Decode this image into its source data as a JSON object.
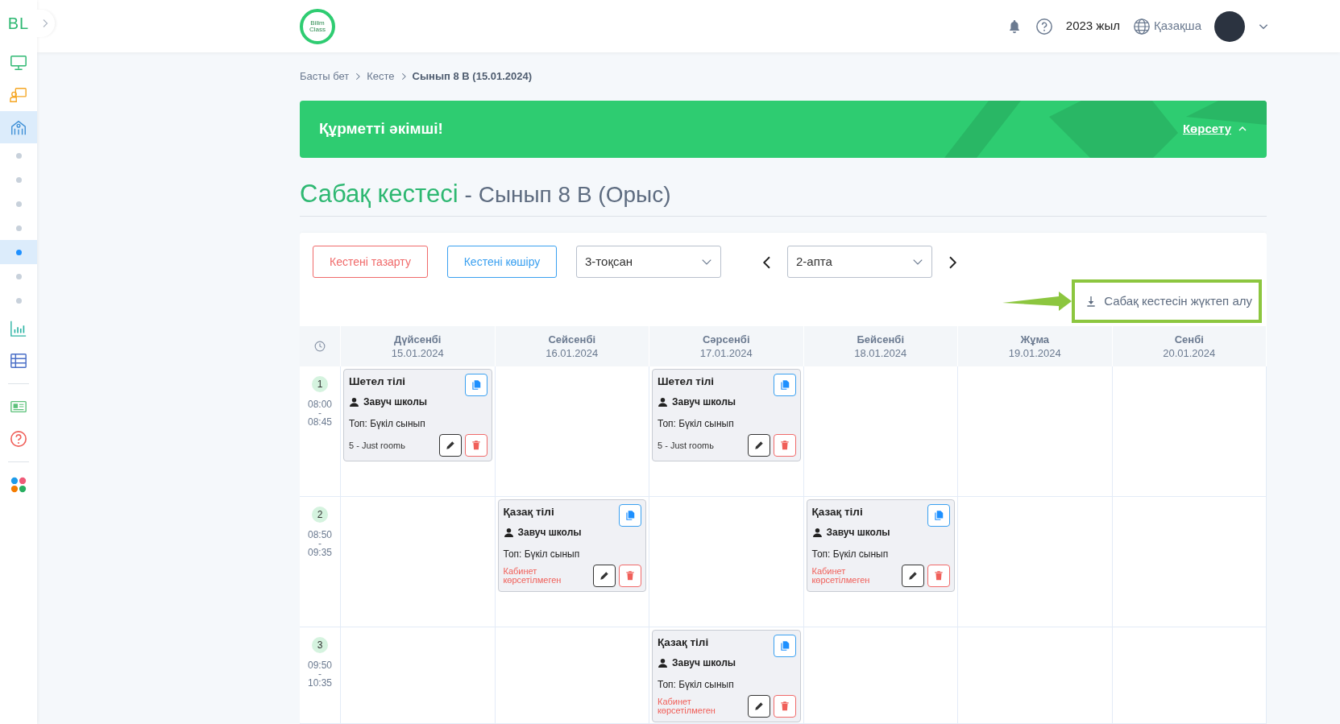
{
  "sidebar": {
    "logo": "BL",
    "items": [
      {
        "kind": "monitor",
        "selected": false
      },
      {
        "kind": "classroom",
        "selected": false
      },
      {
        "kind": "school",
        "selected": true
      },
      {
        "kind": "dot",
        "selected": false
      },
      {
        "kind": "dot",
        "selected": false
      },
      {
        "kind": "dot",
        "selected": false
      },
      {
        "kind": "dot",
        "selected": false
      },
      {
        "kind": "dot",
        "selected": true
      },
      {
        "kind": "dot",
        "selected": false
      },
      {
        "kind": "dot",
        "selected": false
      },
      {
        "kind": "chart",
        "selected": false
      },
      {
        "kind": "table",
        "selected": false
      },
      {
        "kind": "divider"
      },
      {
        "kind": "news",
        "selected": false
      },
      {
        "kind": "help",
        "selected": false
      },
      {
        "kind": "divider"
      },
      {
        "kind": "apps",
        "selected": false
      }
    ]
  },
  "header": {
    "logo_text": "Bilim Class",
    "year": "2023 жыл",
    "language": "Қазақша"
  },
  "breadcrumb": [
    {
      "label": "Басты бет",
      "current": false
    },
    {
      "label": "Кесте",
      "current": false
    },
    {
      "label": "Сынып 8 В (15.01.2024)",
      "current": true
    }
  ],
  "banner": {
    "title": "Құрметті әкімші!",
    "toggle": "Көрсету",
    "expanded": true
  },
  "page_title": {
    "main": "Сабақ кестесі",
    "sub": "- Сынып 8 В (Орыс)"
  },
  "toolbar": {
    "clear_button": "Кестені тазарту",
    "copy_button": "Кестені көшіру",
    "quarter": "3-тоқсан",
    "week": "2-апта",
    "download": "Сабақ кестесін жүктеп алу",
    "download_highlighted": true
  },
  "schedule": {
    "days": [
      {
        "name": "Дүйсенбі",
        "date": "15.01.2024"
      },
      {
        "name": "Сейсенбі",
        "date": "16.01.2024"
      },
      {
        "name": "Сәрсенбі",
        "date": "17.01.2024"
      },
      {
        "name": "Бейсенбі",
        "date": "18.01.2024"
      },
      {
        "name": "Жұма",
        "date": "19.01.2024"
      },
      {
        "name": "Сенбі",
        "date": "20.01.2024"
      }
    ],
    "rows": [
      {
        "number": "1",
        "time": "08:00\n-\n08:45",
        "cells": [
          {
            "subject": "Шетел тілі",
            "teacher": "Завуч школы",
            "group": "Топ: Бүкіл сынып",
            "room": "5 - Just roomь",
            "room_assigned": true
          },
          null,
          {
            "subject": "Шетел тілі",
            "teacher": "Завуч школы",
            "group": "Топ: Бүкіл сынып",
            "room": "5 - Just roomь",
            "room_assigned": true
          },
          null,
          null,
          null
        ]
      },
      {
        "number": "2",
        "time": "08:50\n-\n09:35",
        "cells": [
          null,
          {
            "subject": "Қазақ тілі",
            "teacher": "Завуч школы",
            "group": "Топ: Бүкіл сынып",
            "room": "Кабинет көрсетілмеген",
            "room_assigned": false
          },
          null,
          {
            "subject": "Қазақ тілі",
            "teacher": "Завуч школы",
            "group": "Топ: Бүкіл сынып",
            "room": "Кабинет көрсетілмеген",
            "room_assigned": false
          },
          null,
          null
        ]
      },
      {
        "number": "3",
        "time": "09:50\n-\n10:35",
        "cells": [
          null,
          null,
          {
            "subject": "Қазақ тілі",
            "teacher": "Завуч школы",
            "group": "Топ: Бүкіл сынып",
            "room": "Кабинет көрсетілмеген",
            "room_assigned": false
          },
          null,
          null,
          null
        ]
      }
    ]
  }
}
